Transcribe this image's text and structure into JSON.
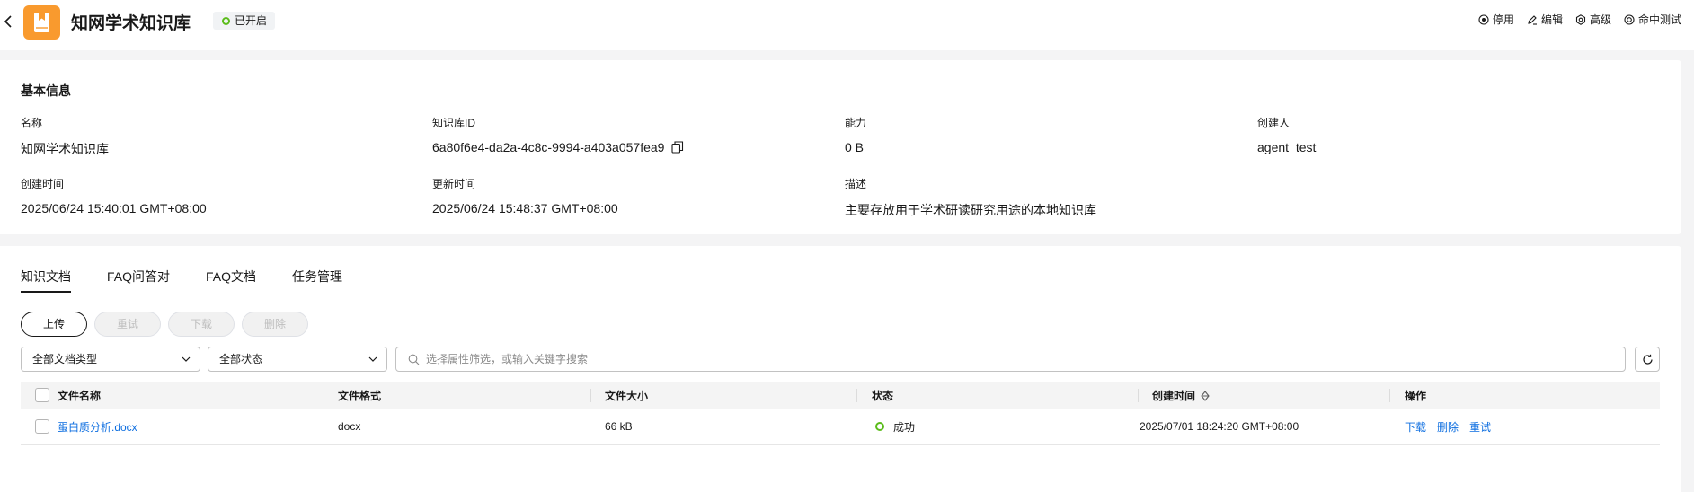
{
  "header": {
    "title": "知网学术知识库",
    "status": "已开启",
    "actions": [
      {
        "label": "停用",
        "icon": "stop-icon"
      },
      {
        "label": "编辑",
        "icon": "edit-icon"
      },
      {
        "label": "高级",
        "icon": "gear-icon"
      },
      {
        "label": "命中测试",
        "icon": "hit-test-icon"
      }
    ]
  },
  "info": {
    "title": "基本信息",
    "fields": [
      {
        "label": "名称",
        "value": "知网学术知识库"
      },
      {
        "label": "知识库ID",
        "value": "6a80f6e4-da2a-4c8c-9994-a403a057fea9"
      },
      {
        "label": "能力",
        "value": "0 B"
      },
      {
        "label": "创建人",
        "value": "agent_test"
      },
      {
        "label": "创建时间",
        "value": "2025/06/24 15:40:01 GMT+08:00"
      },
      {
        "label": "更新时间",
        "value": "2025/06/24 15:48:37 GMT+08:00"
      },
      {
        "label": "描述",
        "value": "主要存放用于学术研读研究用途的本地知识库"
      }
    ]
  },
  "tabs": [
    {
      "label": "知识文档",
      "active": true
    },
    {
      "label": "FAQ问答对",
      "active": false
    },
    {
      "label": "FAQ文档",
      "active": false
    },
    {
      "label": "任务管理",
      "active": false
    }
  ],
  "buttons": {
    "upload": "上传",
    "retry": "重试",
    "download": "下载",
    "delete": "删除"
  },
  "filters": {
    "type_select": "全部文档类型",
    "status_select": "全部状态",
    "search_placeholder": "选择属性筛选，或输入关键字搜索"
  },
  "table": {
    "columns": [
      "文件名称",
      "文件格式",
      "文件大小",
      "状态",
      "创建时间",
      "操作"
    ],
    "rows": [
      {
        "name": "蛋白质分析.docx",
        "format": "docx",
        "size": "66 kB",
        "status": "成功",
        "created": "2025/07/01 18:24:20 GMT+08:00",
        "ops": [
          "下载",
          "删除",
          "重试"
        ]
      }
    ]
  },
  "colors": {
    "logo": "#f99a2e",
    "success": "#5bbc1b",
    "link": "#0d6ee0"
  }
}
